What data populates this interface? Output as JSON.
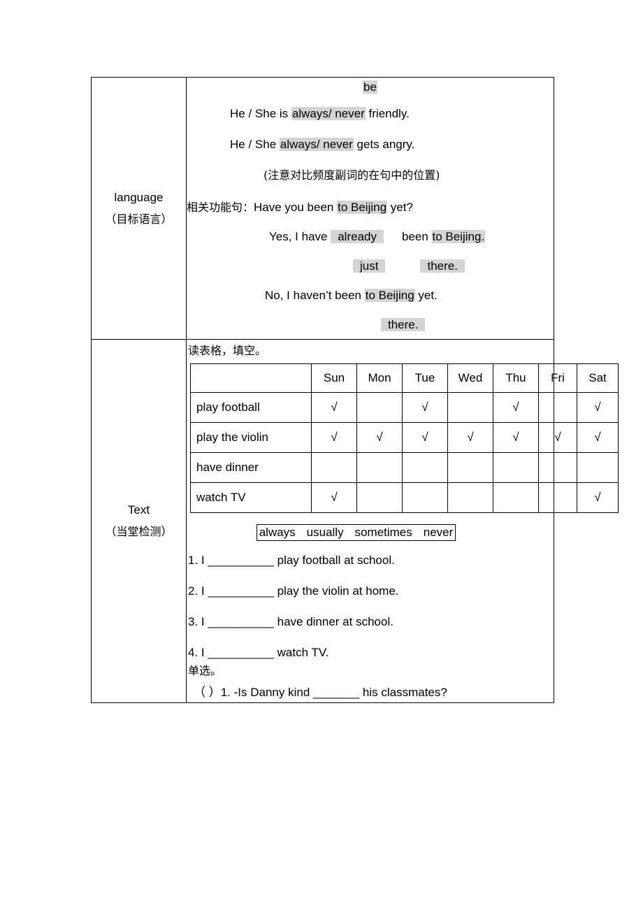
{
  "document": {
    "row_language": {
      "label_en": "language",
      "label_cn": "（目标语言）",
      "title": "be",
      "sentence1_pre": "He / She is ",
      "sentence1_hl": "always/ never",
      "sentence1_post": " friendly.",
      "sentence2_pre": "He / She ",
      "sentence2_hl": "always/ never",
      "sentence2_post": " gets angry.",
      "note_cn": "(注意对比频度副词的在句中的位置)",
      "function_label_cn": "相关功能句：",
      "question_pre": "Have you been ",
      "question_hl": "to Beijing",
      "question_post": " yet?",
      "answer1_pre": "Yes, I have ",
      "answer1_hl": "already",
      "answer1_mid": "been ",
      "answer1_hl2": "to Beijing.",
      "answer2_hl": "just",
      "answer2_hl2": "there.",
      "answer3_pre": "No, I haven’t been ",
      "answer3_hl": "to Beijing",
      "answer3_post": " yet.",
      "answer4_hl": "there."
    },
    "row_text": {
      "label_en": "Text",
      "label_cn": "（当堂检测）",
      "instruction_cn": "读表格，填空。",
      "week_table": {
        "corner": "",
        "days": [
          "Sun",
          "Mon",
          "Tue",
          "Wed",
          "Thu",
          "Fri",
          "Sat"
        ],
        "check_mark": "√",
        "rows": [
          {
            "activity": "play football",
            "marks": [
              true,
              false,
              true,
              false,
              true,
              false,
              true
            ]
          },
          {
            "activity": "play the violin",
            "marks": [
              true,
              true,
              true,
              true,
              true,
              true,
              true
            ]
          },
          {
            "activity": "have dinner",
            "marks": [
              false,
              false,
              false,
              false,
              false,
              false,
              false
            ]
          },
          {
            "activity": "watch TV",
            "marks": [
              true,
              false,
              false,
              false,
              false,
              false,
              true
            ]
          }
        ]
      },
      "word_bank": [
        "always",
        "usually",
        "sometimes",
        "never"
      ],
      "fill_questions": [
        "1. I __________ play football at school.",
        "2. I __________ play the violin at home.",
        "3. I __________ have dinner at school.",
        "4. I __________ watch TV."
      ],
      "mc_instruction_cn": "单选。",
      "mc_question_1": "（ ）1. -Is Danny kind _______ his classmates?"
    }
  }
}
